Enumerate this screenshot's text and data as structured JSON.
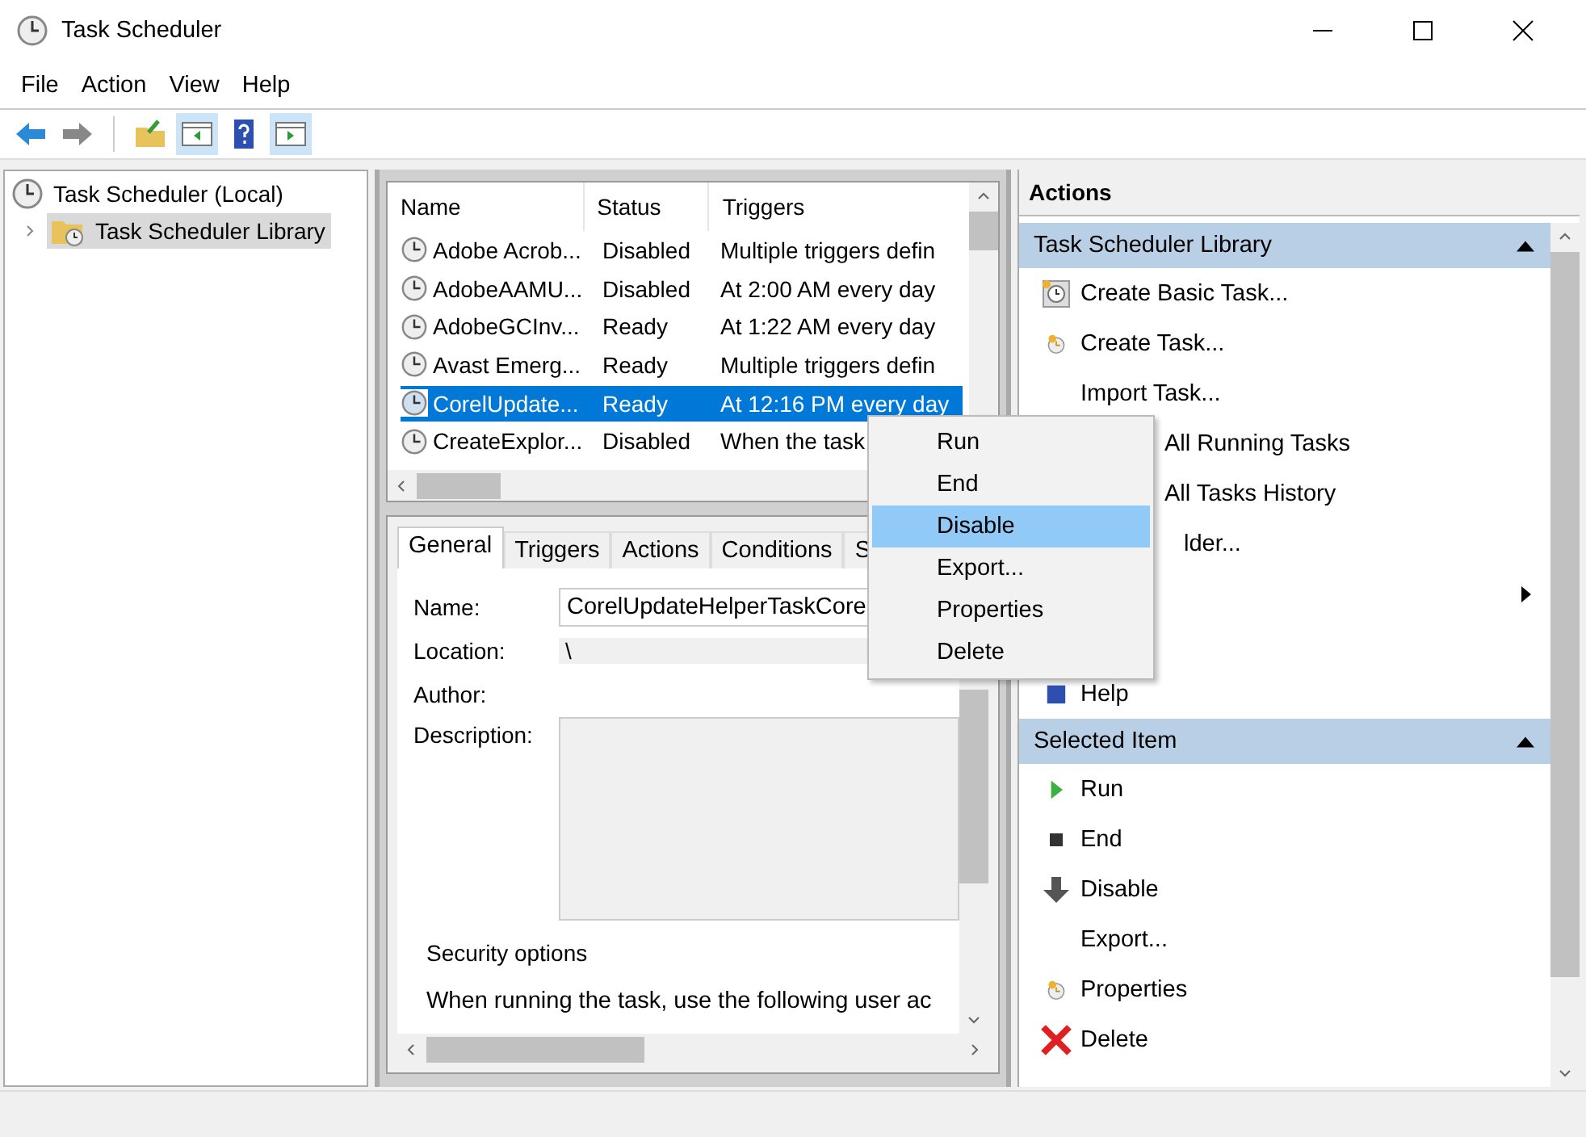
{
  "window": {
    "title": "Task Scheduler"
  },
  "menu": [
    "File",
    "Action",
    "View",
    "Help"
  ],
  "tree": [
    {
      "label": "Task Scheduler (Local)",
      "children": [
        {
          "label": "Task Scheduler Library",
          "expanded": false,
          "selected": true
        }
      ]
    }
  ],
  "task_table": {
    "columns": [
      "Name",
      "Status",
      "Triggers"
    ],
    "rows": [
      {
        "name": "Adobe Acrob...",
        "status": "Disabled",
        "triggers": "Multiple triggers defin",
        "selected": false
      },
      {
        "name": "AdobeAAMU...",
        "status": "Disabled",
        "triggers": "At 2:00 AM every day",
        "selected": false
      },
      {
        "name": "AdobeGCInv...",
        "status": "Ready",
        "triggers": "At 1:22 AM every day",
        "selected": false
      },
      {
        "name": "Avast Emerg...",
        "status": "Ready",
        "triggers": "Multiple triggers defin",
        "selected": false
      },
      {
        "name": "CorelUpdate...",
        "status": "Ready",
        "triggers": "At 12:16 PM every day",
        "selected": true
      },
      {
        "name": "CreateExplor...",
        "status": "Disabled",
        "triggers": "When the task",
        "selected": false
      }
    ]
  },
  "detail": {
    "tabs": [
      {
        "label": "General",
        "selected": true
      },
      {
        "label": "Triggers",
        "selected": false
      },
      {
        "label": "Actions",
        "selected": false
      },
      {
        "label": "Conditions",
        "selected": false
      },
      {
        "label": "S",
        "selected": false
      }
    ],
    "name_label": "Name:",
    "name_value": "CorelUpdateHelperTaskCore",
    "location_label": "Location:",
    "location_value": "\\",
    "author_label": "Author:",
    "description_label": "Description:",
    "security_title": "Security options",
    "security_text": "When running the task, use the following user ac"
  },
  "context_menu": [
    {
      "label": "Run",
      "selected": false
    },
    {
      "label": "End",
      "selected": false
    },
    {
      "label": "Disable",
      "selected": true
    },
    {
      "label": "Export...",
      "selected": false
    },
    {
      "label": "Properties",
      "selected": false
    },
    {
      "label": "Delete",
      "selected": false
    }
  ],
  "actions": {
    "title": "Actions",
    "sections": [
      {
        "title": "Task Scheduler Library",
        "expanded": true,
        "items": [
          {
            "kind": "basic-task",
            "label": "Create Basic Task..."
          },
          {
            "kind": "task",
            "label": "Create Task..."
          },
          {
            "kind": "plain",
            "label": "Import Task..."
          },
          {
            "kind": "covered",
            "label": "All Running Tasks"
          },
          {
            "kind": "covered",
            "label": "All Tasks History"
          },
          {
            "kind": "covered",
            "label": "lder..."
          },
          {
            "kind": "submenu"
          },
          {
            "kind": "covered"
          },
          {
            "kind": "help",
            "label": "Help"
          }
        ]
      },
      {
        "title": "Selected Item",
        "expanded": true,
        "items": [
          {
            "kind": "run",
            "label": "Run"
          },
          {
            "kind": "end",
            "label": "End"
          },
          {
            "kind": "disable",
            "label": "Disable"
          },
          {
            "kind": "plain",
            "label": "Export..."
          },
          {
            "kind": "task",
            "label": "Properties"
          },
          {
            "kind": "delete",
            "label": "Delete"
          }
        ]
      }
    ]
  }
}
